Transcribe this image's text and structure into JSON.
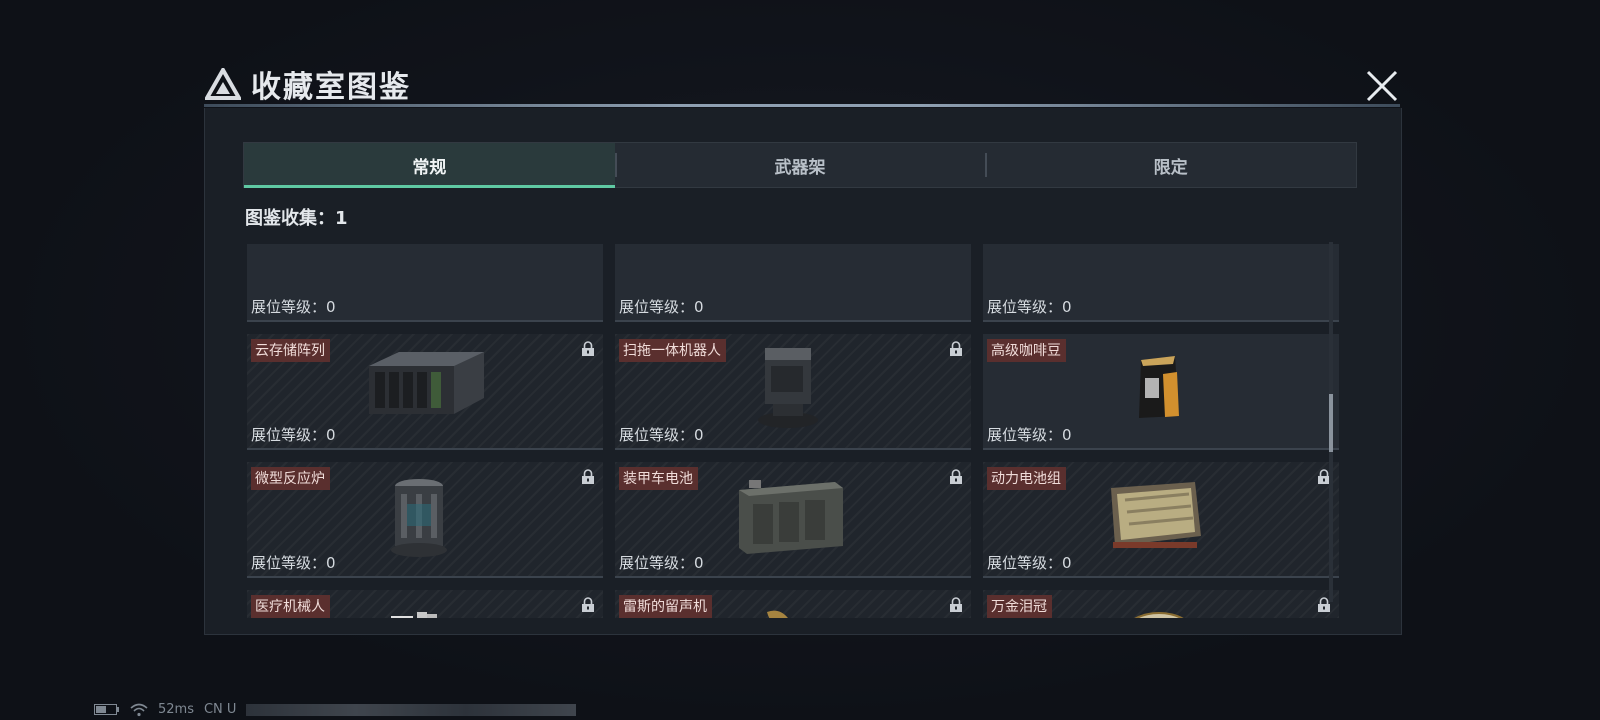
{
  "modal": {
    "title": "收藏室图鉴",
    "tabs": [
      {
        "label": "常规",
        "active": true
      },
      {
        "label": "武器架",
        "active": false
      },
      {
        "label": "限定",
        "active": false
      }
    ],
    "collection_text": "图鉴收集：1"
  },
  "level_label": "展位等级：0",
  "cards": [
    {
      "name": "",
      "locked": false,
      "art": "object-partial-1-icon"
    },
    {
      "name": "",
      "locked": false,
      "art": "object-partial-2-icon"
    },
    {
      "name": "",
      "locked": false,
      "art": "object-partial-3-icon"
    },
    {
      "name": "云存储阵列",
      "locked": true,
      "art": "server-rack-icon"
    },
    {
      "name": "扫拖一体机器人",
      "locked": true,
      "art": "robot-vacuum-icon"
    },
    {
      "name": "高级咖啡豆",
      "locked": false,
      "art": "coffee-bag-icon"
    },
    {
      "name": "微型反应炉",
      "locked": true,
      "art": "reactor-icon"
    },
    {
      "name": "装甲车电池",
      "locked": true,
      "art": "car-battery-icon"
    },
    {
      "name": "动力电池组",
      "locked": true,
      "art": "battery-pack-icon"
    },
    {
      "name": "医疗机械人",
      "locked": true,
      "art": "medical-robot-icon"
    },
    {
      "name": "雷斯的留声机",
      "locked": true,
      "art": "gramophone-icon"
    },
    {
      "name": "万金泪冠",
      "locked": true,
      "art": "jeweled-egg-icon"
    }
  ],
  "status_bar": {
    "ping": "52ms",
    "region": "CN U"
  },
  "colors": {
    "accent": "#5fc9a3",
    "tag_bg": "#5a2f2e"
  }
}
